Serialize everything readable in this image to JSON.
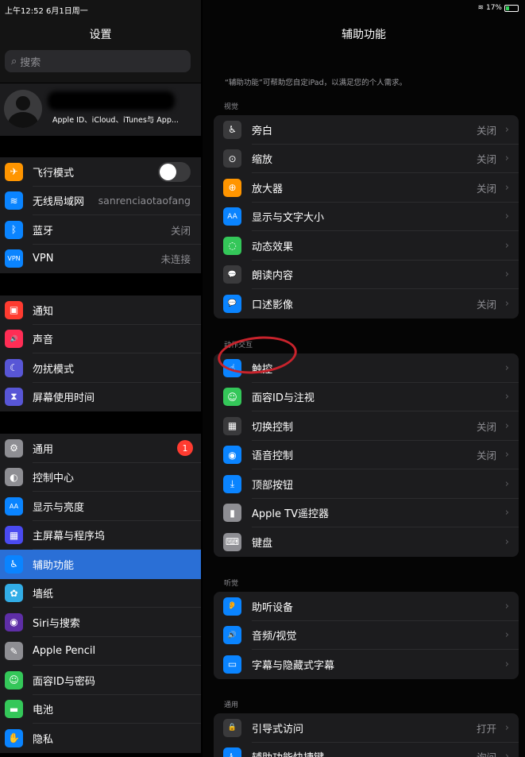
{
  "status": {
    "time_date": "上午12:52  6月1日周一",
    "battery": "17%"
  },
  "sidebar": {
    "title": "设置",
    "search_placeholder": "搜索",
    "profile_subtitle": "Apple ID、iCloud、iTunes与 App...",
    "groups": [
      [
        {
          "label": "飞行模式",
          "icon": "airplane-icon",
          "color": "#ff9500",
          "glyph": "✈",
          "toggle": true
        },
        {
          "label": "无线局域网",
          "icon": "wifi-icon",
          "color": "#0a84ff",
          "glyph": "≋",
          "value": "sanrenciaotaofang"
        },
        {
          "label": "蓝牙",
          "icon": "bluetooth-icon",
          "color": "#0a84ff",
          "glyph": "ᛒ",
          "value": "关闭"
        },
        {
          "label": "VPN",
          "icon": "vpn-icon",
          "color": "#0a84ff",
          "glyph": "VPN",
          "value": "未连接"
        }
      ],
      [
        {
          "label": "通知",
          "icon": "notifications-icon",
          "color": "#ff3b30",
          "glyph": "▣"
        },
        {
          "label": "声音",
          "icon": "sound-icon",
          "color": "#ff2d55",
          "glyph": "🔊"
        },
        {
          "label": "勿扰模式",
          "icon": "moon-icon",
          "color": "#5856d6",
          "glyph": "☾"
        },
        {
          "label": "屏幕使用时间",
          "icon": "hourglass-icon",
          "color": "#5856d6",
          "glyph": "⧗"
        }
      ],
      [
        {
          "label": "通用",
          "icon": "gear-icon",
          "color": "#8e8e93",
          "glyph": "⚙",
          "badge": "1"
        },
        {
          "label": "控制中心",
          "icon": "control-center-icon",
          "color": "#8e8e93",
          "glyph": "◐"
        },
        {
          "label": "显示与亮度",
          "icon": "display-icon",
          "color": "#0a84ff",
          "glyph": "AA"
        },
        {
          "label": "主屏幕与程序坞",
          "icon": "home-screen-icon",
          "color": "#4a4af0",
          "glyph": "▦"
        },
        {
          "label": "辅助功能",
          "icon": "accessibility-icon",
          "color": "#0a84ff",
          "glyph": "♿",
          "active": true
        },
        {
          "label": "墙纸",
          "icon": "wallpaper-icon",
          "color": "#32ade6",
          "glyph": "✿"
        },
        {
          "label": "Siri与搜索",
          "icon": "siri-icon",
          "color": "#5e2ea6",
          "glyph": "◉"
        },
        {
          "label": "Apple Pencil",
          "icon": "pencil-icon",
          "color": "#8e8e93",
          "glyph": "✎"
        },
        {
          "label": "面容ID与密码",
          "icon": "face-id-icon",
          "color": "#34c759",
          "glyph": "☺"
        },
        {
          "label": "电池",
          "icon": "battery-icon",
          "color": "#34c759",
          "glyph": "▬"
        },
        {
          "label": "隐私",
          "icon": "hand-icon",
          "color": "#0a84ff",
          "glyph": "✋"
        }
      ]
    ]
  },
  "main": {
    "title": "辅助功能",
    "description": "“辅助功能”可帮助您自定iPad，以满足您的个人需求。",
    "sections": [
      {
        "header": "视觉",
        "rows": [
          {
            "label": "旁白",
            "icon": "voiceover-icon",
            "color": "#3a3a3c",
            "glyph": "♿",
            "value": "关闭"
          },
          {
            "label": "缩放",
            "icon": "zoom-icon",
            "color": "#3a3a3c",
            "glyph": "⊙",
            "value": "关闭"
          },
          {
            "label": "放大器",
            "icon": "magnifier-icon",
            "color": "#ff9500",
            "glyph": "⊕",
            "value": "关闭"
          },
          {
            "label": "显示与文字大小",
            "icon": "text-size-icon",
            "color": "#0a84ff",
            "glyph": "AA",
            "value": ""
          },
          {
            "label": "动态效果",
            "icon": "motion-icon",
            "color": "#34c759",
            "glyph": "◌",
            "value": ""
          },
          {
            "label": "朗读内容",
            "icon": "speech-icon",
            "color": "#3a3a3c",
            "glyph": "💬",
            "value": ""
          },
          {
            "label": "口述影像",
            "icon": "audio-description-icon",
            "color": "#0a84ff",
            "glyph": "💬",
            "value": "关闭"
          }
        ]
      },
      {
        "header": "动作交互",
        "rows": [
          {
            "label": "触控",
            "icon": "touch-icon",
            "color": "#0a84ff",
            "glyph": "☝",
            "value": ""
          },
          {
            "label": "面容ID与注视",
            "icon": "face-id-icon",
            "color": "#34c759",
            "glyph": "☺",
            "value": ""
          },
          {
            "label": "切换控制",
            "icon": "switch-control-icon",
            "color": "#3a3a3c",
            "glyph": "▦",
            "value": "关闭"
          },
          {
            "label": "语音控制",
            "icon": "voice-control-icon",
            "color": "#0a84ff",
            "glyph": "◉",
            "value": "关闭"
          },
          {
            "label": "顶部按钮",
            "icon": "top-button-icon",
            "color": "#0a84ff",
            "glyph": "⤓",
            "value": ""
          },
          {
            "label": "Apple TV遥控器",
            "icon": "remote-icon",
            "color": "#8e8e93",
            "glyph": "▮",
            "value": ""
          },
          {
            "label": "键盘",
            "icon": "keyboard-icon",
            "color": "#8e8e93",
            "glyph": "⌨",
            "value": ""
          }
        ]
      },
      {
        "header": "听觉",
        "rows": [
          {
            "label": "助听设备",
            "icon": "hearing-icon",
            "color": "#0a84ff",
            "glyph": "👂",
            "value": ""
          },
          {
            "label": "音频/视觉",
            "icon": "audio-visual-icon",
            "color": "#0a84ff",
            "glyph": "🔊",
            "value": ""
          },
          {
            "label": "字幕与隐藏式字幕",
            "icon": "subtitles-icon",
            "color": "#0a84ff",
            "glyph": "▭",
            "value": ""
          }
        ]
      },
      {
        "header": "通用",
        "rows": [
          {
            "label": "引导式访问",
            "icon": "lock-icon",
            "color": "#3a3a3c",
            "glyph": "🔒",
            "value": "打开"
          },
          {
            "label": "辅助功能快捷键",
            "icon": "accessibility-shortcut-icon",
            "color": "#0a84ff",
            "glyph": "♿",
            "value": "询问"
          }
        ]
      }
    ]
  }
}
